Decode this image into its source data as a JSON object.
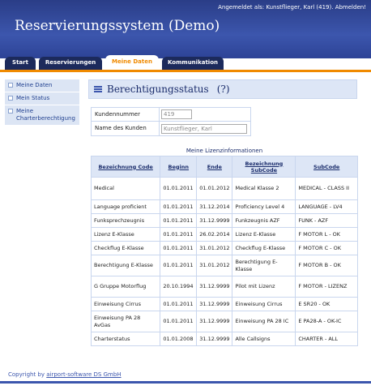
{
  "header": {
    "login_text": "Angemeldet als: Kunstflieger, Karl (419).",
    "logout_label": "Abmelden!",
    "app_title": "Reservierungssystem (Demo)"
  },
  "tabs": [
    {
      "label": "Start",
      "active": false
    },
    {
      "label": "Reservierungen",
      "active": false
    },
    {
      "label": "Meine Daten",
      "active": true
    },
    {
      "label": "Kommunikation",
      "active": false
    }
  ],
  "sidebar": {
    "items": [
      {
        "label": "Meine Daten"
      },
      {
        "label": "Mein Status"
      },
      {
        "label": "Meine Charterberechtigung"
      }
    ]
  },
  "main": {
    "title": "Berechtigungsstatus",
    "help": "(?)",
    "kunde": {
      "nummer_label": "Kundennummer",
      "nummer_value": "419",
      "name_label": "Name des Kunden",
      "name_value": "Kunstflieger, Karl"
    },
    "lizenz": {
      "caption": "Meine Lizenzinformationen",
      "headers": [
        "Bezeichnung Code",
        "Beginn",
        "Ende",
        "Bezeichnung SubCode",
        "SubCode"
      ],
      "rows": [
        [
          "Medical",
          "01.01.2011",
          "01.01.2012",
          "Medical Klasse 2",
          "MEDICAL - CLASS II"
        ],
        [
          "Language proficient",
          "01.01.2011",
          "31.12.2014",
          "Proficiency Level 4",
          "LANGUAGE - LV4"
        ],
        [
          "Funksprechzeugnis",
          "01.01.2011",
          "31.12.9999",
          "Funkzeugnis AZF",
          "FUNK - AZF"
        ],
        [
          "Lizenz E-Klasse",
          "01.01.2011",
          "26.02.2014",
          "Lizenz E-Klasse",
          "F MOTOR L - OK"
        ],
        [
          "Checkflug E-Klasse",
          "01.01.2011",
          "31.01.2012",
          "Checkflug E-Klasse",
          "F MOTOR C - OK"
        ],
        [
          "Berechtigung E-Klasse",
          "01.01.2011",
          "31.01.2012",
          "Berechtigung E-Klasse",
          "F MOTOR B - OK"
        ],
        [
          "G Gruppe Motorflug",
          "20.10.1994",
          "31.12.9999",
          "Pilot mit Lizenz",
          "F MOTOR - LIZENZ"
        ],
        [
          "Einweisung Cirrus",
          "01.01.2011",
          "31.12.9999",
          "Einweisung Cirrus",
          "E SR20 - OK"
        ],
        [
          "Einweisung PA 28 AvGas",
          "01.01.2011",
          "31.12.9999",
          "Einweisung PA 28 IC",
          "E PA28-A - OK-IC"
        ],
        [
          "Charterstatus",
          "01.01.2008",
          "31.12.9999",
          "Alle Callsigns",
          "CHARTER - ALL"
        ]
      ]
    }
  },
  "footer": {
    "prefix": "Copyright by",
    "link": "airport-software DS GmbH"
  },
  "colors": {
    "header_blue": "#3c56ad",
    "tab_dark": "#1c2a5c",
    "accent_orange": "#f08a00",
    "panel_light": "#dde6f6"
  }
}
